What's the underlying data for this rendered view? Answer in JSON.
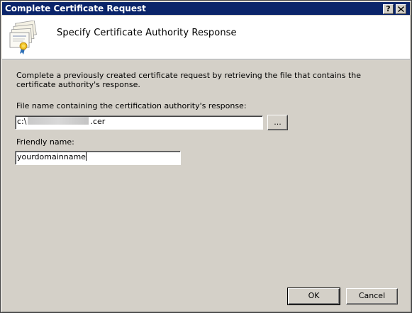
{
  "window": {
    "title": "Complete Certificate Request",
    "help_label": "?",
    "close_label": "X"
  },
  "header": {
    "title": "Specify Certificate Authority Response",
    "icon": "certificate-icon"
  },
  "content": {
    "description": "Complete a previously created certificate request by retrieving the file that contains the certificate authority's response.",
    "file_label": "File name containing the certification authority's response:",
    "file_value_prefix": "c:\\",
    "file_value_suffix": ".cer",
    "browse_label": "...",
    "friendly_label": "Friendly name:",
    "friendly_value": "yourdomainname"
  },
  "buttons": {
    "ok": "OK",
    "cancel": "Cancel"
  }
}
